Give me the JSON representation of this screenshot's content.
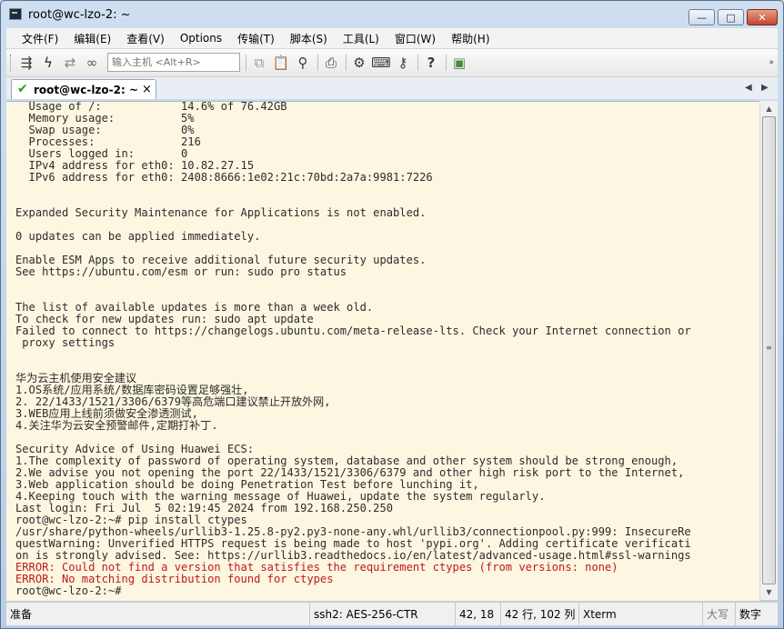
{
  "window": {
    "title": "root@wc-lzo-2: ~",
    "buttons": {
      "minimize": "—",
      "maximize": "□",
      "close": "✕"
    }
  },
  "menubar": {
    "items": [
      "文件(F)",
      "编辑(E)",
      "查看(V)",
      "Options",
      "传输(T)",
      "脚本(S)",
      "工具(L)",
      "窗口(W)",
      "帮助(H)"
    ]
  },
  "toolbar": {
    "host_placeholder": "输入主机 <Alt+R>",
    "icons": [
      "connect-icon",
      "lightning-icon",
      "reconnect-icon",
      "link-icon",
      "copy-icon",
      "paste-icon",
      "find-icon",
      "print-icon",
      "settings-icon",
      "keymap-icon",
      "key-icon",
      "help-icon",
      "screen-icon"
    ]
  },
  "tabs": [
    {
      "label": "root@wc-lzo-2: ~",
      "close": "×"
    }
  ],
  "terminal": {
    "lines": [
      {
        "text": "  Usage of /:            14.6% of 76.42GB"
      },
      {
        "text": "  Memory usage:          5%"
      },
      {
        "text": "  Swap usage:            0%"
      },
      {
        "text": "  Processes:             216"
      },
      {
        "text": "  Users logged in:       0"
      },
      {
        "text": "  IPv4 address for eth0: 10.82.27.15"
      },
      {
        "text": "  IPv6 address for eth0: 2408:8666:1e02:21c:70bd:2a7a:9981:7226"
      },
      {
        "text": ""
      },
      {
        "text": ""
      },
      {
        "text": "Expanded Security Maintenance for Applications is not enabled."
      },
      {
        "text": ""
      },
      {
        "text": "0 updates can be applied immediately."
      },
      {
        "text": ""
      },
      {
        "text": "Enable ESM Apps to receive additional future security updates."
      },
      {
        "text": "See https://ubuntu.com/esm or run: sudo pro status"
      },
      {
        "text": ""
      },
      {
        "text": ""
      },
      {
        "text": "The list of available updates is more than a week old."
      },
      {
        "text": "To check for new updates run: sudo apt update"
      },
      {
        "text": "Failed to connect to https://changelogs.ubuntu.com/meta-release-lts. Check your Internet connection or"
      },
      {
        "text": " proxy settings"
      },
      {
        "text": ""
      },
      {
        "text": ""
      },
      {
        "text": "华为云主机使用安全建议"
      },
      {
        "text": "1.OS系统/应用系统/数据库密码设置足够强壮,"
      },
      {
        "text": "2. 22/1433/1521/3306/6379等高危端口建议禁止开放外网,"
      },
      {
        "text": "3.WEB应用上线前须做安全渗透测试,"
      },
      {
        "text": "4.关注华为云安全预警邮件,定期打补丁."
      },
      {
        "text": ""
      },
      {
        "text": "Security Advice of Using Huawei ECS:"
      },
      {
        "text": "1.The complexity of password of operating system, database and other system should be strong enough,"
      },
      {
        "text": "2.We advise you not opening the port 22/1433/1521/3306/6379 and other high risk port to the Internet,"
      },
      {
        "text": "3.Web application should be doing Penetration Test before lunching it,"
      },
      {
        "text": "4.Keeping touch with the warning message of Huawei, update the system regularly."
      },
      {
        "text": "Last login: Fri Jul  5 02:19:45 2024 from 192.168.250.250"
      },
      {
        "text": "root@wc-lzo-2:~# pip install ctypes"
      },
      {
        "text": "/usr/share/python-wheels/urllib3-1.25.8-py2.py3-none-any.whl/urllib3/connectionpool.py:999: InsecureRe"
      },
      {
        "text": "questWarning: Unverified HTTPS request is being made to host 'pypi.org'. Adding certificate verificati"
      },
      {
        "text": "on is strongly advised. See: https://urllib3.readthedocs.io/en/latest/advanced-usage.html#ssl-warnings"
      },
      {
        "text": "ERROR: Could not find a version that satisfies the requirement ctypes (from versions: none)",
        "type": "error"
      },
      {
        "text": "ERROR: No matching distribution found for ctypes",
        "type": "error"
      },
      {
        "text": "root@wc-lzo-2:~#"
      }
    ],
    "colors": {
      "background": "#fdf6e1",
      "text": "#2c2c2c",
      "error": "#c11a1a"
    }
  },
  "statusbar": {
    "ready": "准备",
    "cipher": "ssh2: AES-256-CTR",
    "cursor": "42,  18",
    "size": "42 行, 102 列",
    "term": "Xterm",
    "caps": "大写",
    "num": "数字"
  }
}
